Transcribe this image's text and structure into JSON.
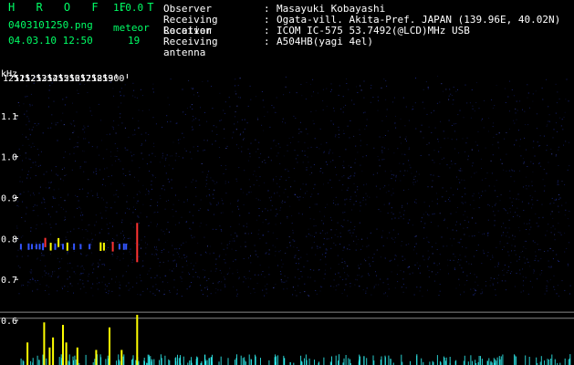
{
  "header": {
    "app_title": "H R O F F T",
    "app_version": "1.0.0",
    "file_name": "0403101250.png",
    "timestamp": "04.03.10 12:50",
    "meteor_label": "meteor",
    "meteor_count": "19",
    "info": [
      {
        "key": "Observer",
        "sep": ":",
        "value": "Masayuki Kobayashi"
      },
      {
        "key": "Receiving Location",
        "sep": ":",
        "value": "Ogata-vill. Akita-Pref. JAPAN (139.96E, 40.02N)"
      },
      {
        "key": "Receiver",
        "sep": ":",
        "value": "ICOM IC-575 53.7492(@LCD)MHz USB"
      },
      {
        "key": "Receiving antenna",
        "sep": ":",
        "value": "A504HB(yagi 4el)"
      }
    ]
  },
  "chart_data": {
    "type": "heatmap",
    "title": "",
    "xlabel": "",
    "ylabel": "kHz",
    "x_ticks": [
      "1251",
      "1252",
      "1253",
      "1254",
      "1255",
      "1256",
      "1257",
      "1258",
      "1259",
      "1300"
    ],
    "y_ticks": [
      "1.1",
      "1.0",
      "0.9",
      "0.8",
      "0.7",
      "0.6"
    ],
    "ylim": [
      0.58,
      1.2
    ],
    "xlim": [
      1250,
      1300
    ],
    "events": [
      {
        "time": 1250.4,
        "freq": 0.78,
        "intensity": 0.4
      },
      {
        "time": 1251.1,
        "freq": 0.78,
        "intensity": 0.5
      },
      {
        "time": 1251.4,
        "freq": 0.78,
        "intensity": 0.35
      },
      {
        "time": 1251.8,
        "freq": 0.78,
        "intensity": 0.35
      },
      {
        "time": 1252.1,
        "freq": 0.78,
        "intensity": 0.4
      },
      {
        "time": 1252.4,
        "freq": 0.78,
        "intensity": 0.6
      },
      {
        "time": 1252.6,
        "freq": 0.79,
        "intensity": 0.9
      },
      {
        "time": 1253.1,
        "freq": 0.78,
        "intensity": 0.7
      },
      {
        "time": 1253.5,
        "freq": 0.78,
        "intensity": 0.5
      },
      {
        "time": 1253.8,
        "freq": 0.79,
        "intensity": 0.85
      },
      {
        "time": 1254.2,
        "freq": 0.78,
        "intensity": 0.4
      },
      {
        "time": 1254.6,
        "freq": 0.78,
        "intensity": 0.75
      },
      {
        "time": 1255.2,
        "freq": 0.78,
        "intensity": 0.5
      },
      {
        "time": 1255.8,
        "freq": 0.78,
        "intensity": 0.35
      },
      {
        "time": 1256.6,
        "freq": 0.78,
        "intensity": 0.35
      },
      {
        "time": 1257.6,
        "freq": 0.78,
        "intensity": 0.8
      },
      {
        "time": 1257.9,
        "freq": 0.78,
        "intensity": 0.7
      },
      {
        "time": 1258.7,
        "freq": 0.78,
        "intensity": 0.95
      },
      {
        "time": 1259.3,
        "freq": 0.78,
        "intensity": 0.4
      },
      {
        "time": 1259.7,
        "freq": 0.78,
        "intensity": 0.5
      },
      {
        "time": 1259.9,
        "freq": 0.78,
        "intensity": 0.45
      },
      {
        "time": 1260.9,
        "freq": 0.79,
        "intensity": 1.0
      }
    ],
    "power_series": {
      "name": "",
      "peaks": [
        {
          "time": 1251.0,
          "value": 0.45
        },
        {
          "time": 1252.5,
          "value": 0.85
        },
        {
          "time": 1253.0,
          "value": 0.35
        },
        {
          "time": 1253.3,
          "value": 0.55
        },
        {
          "time": 1254.2,
          "value": 0.8
        },
        {
          "time": 1254.5,
          "value": 0.45
        },
        {
          "time": 1255.5,
          "value": 0.35
        },
        {
          "time": 1257.2,
          "value": 0.3
        },
        {
          "time": 1258.4,
          "value": 0.75
        },
        {
          "time": 1259.5,
          "value": 0.3
        },
        {
          "time": 1260.9,
          "value": 1.0
        }
      ]
    }
  },
  "colors": {
    "background": "#000000",
    "header_accent": "#00ff66",
    "grid_line": "#888888",
    "noise": "#2233aa",
    "signal_low": "#3355ff",
    "signal_mid": "#ffff00",
    "signal_high": "#ff3333",
    "power_bar": "#ffff00",
    "power_bar_low": "#33ffff"
  }
}
